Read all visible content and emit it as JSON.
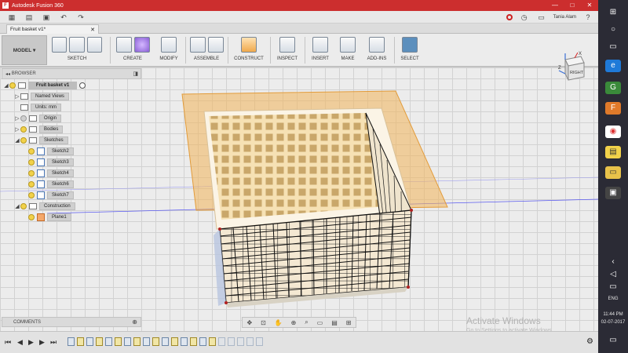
{
  "window": {
    "title": "Autodesk Fusion 360",
    "min": "—",
    "max": "□",
    "close": "✕"
  },
  "quick": {
    "user": "Tania Alam",
    "help": "?"
  },
  "tab": {
    "label": "Fruit basket v1*",
    "close": "✕"
  },
  "toolbar": {
    "workspace": "MODEL",
    "groups": [
      "SKETCH",
      "CREATE",
      "MODIFY",
      "ASSEMBLE",
      "CONSTRUCT",
      "INSPECT",
      "INSERT",
      "MAKE",
      "ADD-INS",
      "SELECT"
    ]
  },
  "browser": {
    "title": "BROWSER",
    "collapse": "◨"
  },
  "tree": {
    "root": "Fruit basket v1",
    "named_views": "Named Views",
    "units": "Units: mm",
    "origin": "Origin",
    "bodies": "Bodies",
    "sketches": "Sketches",
    "sketch_items": [
      "Sketch2",
      "Sketch3",
      "Sketch4",
      "Sketch6",
      "Sketch7"
    ],
    "construction": "Construction",
    "plane": "Plane1"
  },
  "comments": {
    "label": "COMMENTS",
    "plus": "⊕"
  },
  "viewcube": {
    "face": "RIGHT",
    "axis_z": "Z",
    "axis_x": "X"
  },
  "watermark": {
    "title": "Activate Windows",
    "subtitle": "Go to Settings to activate Windows."
  },
  "taskbar": {
    "lang": "ENG",
    "time": "11:44 PM",
    "date": "02-07-2017"
  },
  "colors": {
    "title_bar": "#cc2e2e",
    "basket_wood": "#f3d9a5",
    "plane": "#f2b45a",
    "taskbar": "#2b2b35"
  }
}
